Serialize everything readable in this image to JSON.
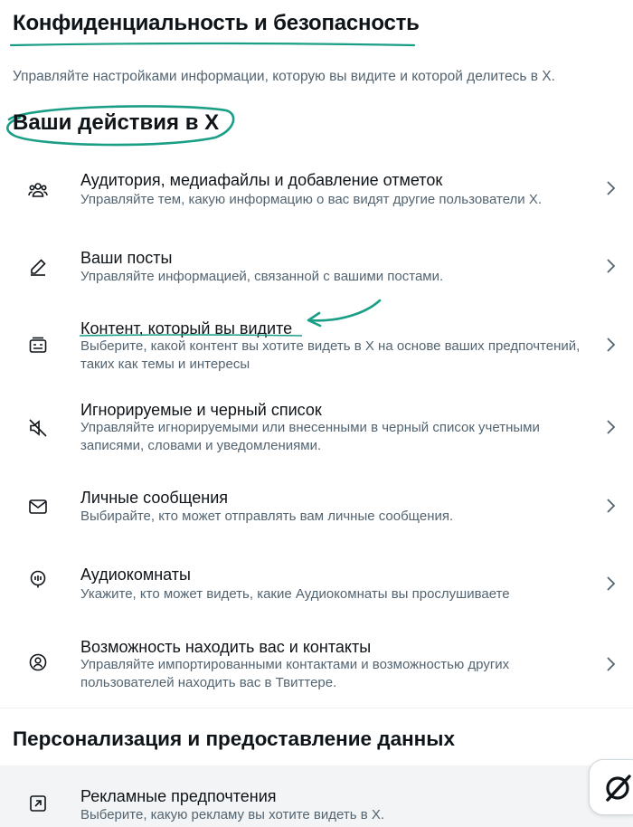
{
  "page": {
    "title": "Конфиденциальность и безопасность",
    "subtitle": "Управляйте настройками информации, которую вы видите и которой делитесь в X."
  },
  "section1": {
    "title": "Ваши действия в X",
    "items": [
      {
        "label": "Аудитория, медиафайлы и добавление отметок",
        "desc": "Управляйте тем, какую информацию о вас видят другие пользователи X.",
        "icon": "people-icon"
      },
      {
        "label": "Ваши посты",
        "desc": "Управляйте информацией, связанной с вашими постами.",
        "icon": "pencil-icon"
      },
      {
        "label": "Контент, который вы видите",
        "desc": "Выберите, какой контент вы хотите видеть в X на основе ваших предпочтений, таких как темы и интересы",
        "icon": "content-icon"
      },
      {
        "label": "Игнорируемые и черный список",
        "desc": "Управляйте игнорируемыми или внесенными в черный список учетными записями, словами и уведомлениями.",
        "icon": "mute-icon"
      },
      {
        "label": "Личные сообщения",
        "desc": "Выбирайте, кто может отправлять вам личные сообщения.",
        "icon": "envelope-icon"
      },
      {
        "label": "Аудиокомнаты",
        "desc": "Укажите, кто может видеть, какие Аудиокомнаты вы прослушиваете",
        "icon": "spaces-icon"
      },
      {
        "label": "Возможность находить вас и контакты",
        "desc": "Управляйте импортированными контактами и возможностью других пользователей находить вас в Твиттере.",
        "icon": "discoverability-icon"
      }
    ]
  },
  "section2": {
    "title": "Персонализация и предоставление данных",
    "items": [
      {
        "label": "Рекламные предпочтения",
        "desc": "Выберите, какую рекламу вы хотите видеть в X.",
        "icon": "external-link-icon"
      }
    ]
  },
  "colors": {
    "accent_annotation": "#1a9f86",
    "text_primary": "#0f1419",
    "text_secondary": "#536471"
  }
}
